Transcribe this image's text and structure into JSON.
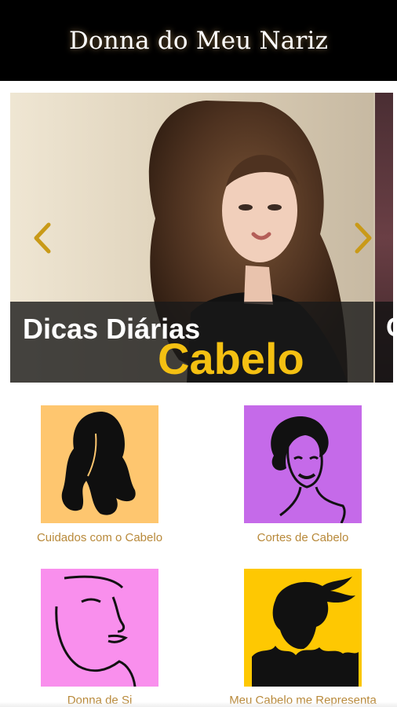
{
  "header": {
    "title": "Donna do Meu Nariz"
  },
  "carousel": {
    "slide_caption_line1": "Dicas Diárias",
    "slide_caption_line2": "Cabelo",
    "next_slide_glyph": "C"
  },
  "categories": [
    {
      "label": "Cuidados com o Cabelo",
      "bg": "#fec66f",
      "icon": "long-hair-silhouette-icon"
    },
    {
      "label": "Cortes de Cabelo",
      "bg": "#c56ae9",
      "icon": "vintage-woman-portrait-icon"
    },
    {
      "label": "Donna de Si",
      "bg": "#f98fed",
      "icon": "face-line-art-icon"
    },
    {
      "label": "Meu Cabelo me Representa",
      "bg": "#fec802",
      "icon": "wind-hair-silhouette-icon"
    }
  ],
  "colors": {
    "header_bg": "#000000",
    "label_color": "#b8893a",
    "accent_yellow": "#f4c012",
    "arrow_color": "#c99a18"
  }
}
